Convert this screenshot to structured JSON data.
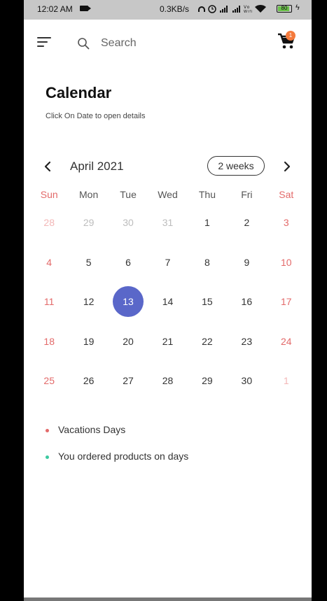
{
  "status_bar": {
    "time": "12:02 AM",
    "speed": "0.3KB/s",
    "icons": "℧ ⏰ .❙❙ .❙❙ Vo △",
    "battery": "80",
    "battery_level": 0.8
  },
  "app_bar": {
    "search_placeholder": "Search",
    "cart_count": "1",
    "accent_color": "#f47a3c"
  },
  "page": {
    "title": "Calendar",
    "subtitle": "Click On Date to open details"
  },
  "calendar": {
    "month": "April 2021",
    "view_toggle": "2 weeks",
    "weekdays": [
      "Sun",
      "Mon",
      "Tue",
      "Wed",
      "Thu",
      "Fri",
      "Sat"
    ],
    "weeks": [
      [
        "28",
        "29",
        "30",
        "31",
        "1",
        "2",
        "3"
      ],
      [
        "4",
        "5",
        "6",
        "7",
        "8",
        "9",
        "10"
      ],
      [
        "11",
        "12",
        "13",
        "14",
        "15",
        "16",
        "17"
      ],
      [
        "18",
        "19",
        "20",
        "21",
        "22",
        "23",
        "24"
      ],
      [
        "25",
        "26",
        "27",
        "28",
        "29",
        "30",
        "1"
      ]
    ],
    "selected_day": "13",
    "selected_color": "#5a67c9",
    "weekend_color": "#e36a6a"
  },
  "legend": [
    {
      "label": "Vacations Days",
      "color": "#e36a6a"
    },
    {
      "label": "You ordered products on days",
      "color": "#3cc9a0"
    }
  ]
}
